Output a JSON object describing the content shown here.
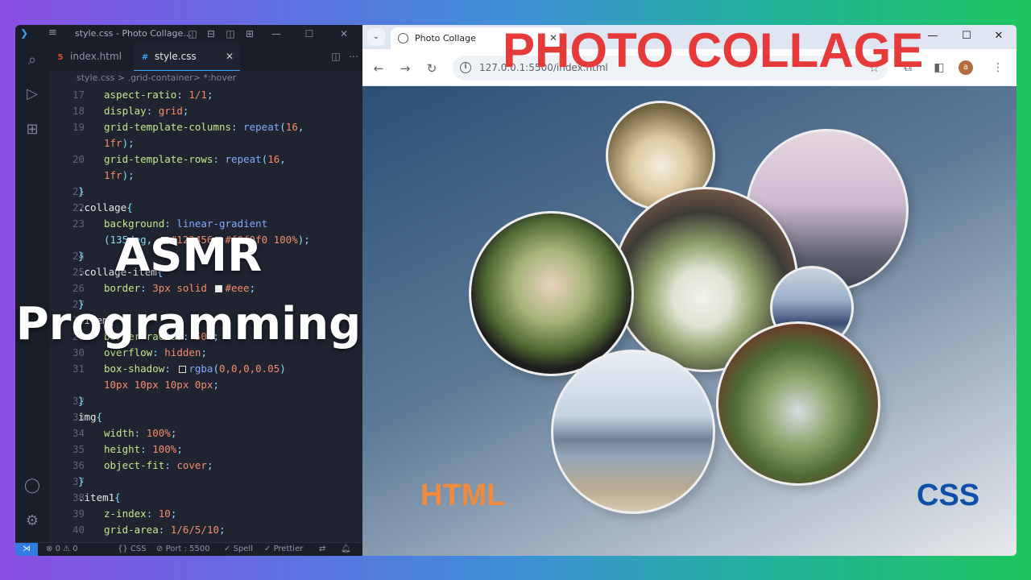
{
  "headline": "PHOTO COLLAGE",
  "overlay": {
    "line1": "ASMR",
    "line2": "Programming"
  },
  "vscode": {
    "window_title": "style.css - Photo Collage...",
    "tabs": [
      {
        "label": "index.html",
        "icon": "html5-icon"
      },
      {
        "label": "style.css",
        "icon": "css-icon"
      }
    ],
    "breadcrumb": {
      "file": "style.css",
      "sep": ">",
      "symbol": ".grid-container> *:hover"
    },
    "lines": [
      {
        "n": "17",
        "parts": [
          [
            "prop",
            "aspect-ratio"
          ],
          [
            "punct",
            ": "
          ],
          [
            "num",
            "1/1"
          ],
          [
            "punct",
            ";"
          ]
        ]
      },
      {
        "n": "18",
        "parts": [
          [
            "prop",
            "display"
          ],
          [
            "punct",
            ": "
          ],
          [
            "val",
            "grid"
          ],
          [
            "punct",
            ";"
          ]
        ]
      },
      {
        "n": "19",
        "parts": [
          [
            "prop",
            "grid-template-columns"
          ],
          [
            "punct",
            ": "
          ],
          [
            "fn",
            "repeat"
          ],
          [
            "punct",
            "("
          ],
          [
            "num",
            "16"
          ],
          [
            "punct",
            ","
          ]
        ]
      },
      {
        "n": "",
        "parts": [
          [
            "num",
            "1fr"
          ],
          [
            "punct",
            ");"
          ]
        ]
      },
      {
        "n": "20",
        "parts": [
          [
            "prop",
            "grid-template-rows"
          ],
          [
            "punct",
            ": "
          ],
          [
            "fn",
            "repeat"
          ],
          [
            "punct",
            "("
          ],
          [
            "num",
            "16"
          ],
          [
            "punct",
            ","
          ]
        ]
      },
      {
        "n": "",
        "parts": [
          [
            "num",
            "1fr"
          ],
          [
            "punct",
            ");"
          ]
        ]
      },
      {
        "n": "21",
        "indent": 0,
        "parts": [
          [
            "punct",
            "}"
          ]
        ]
      },
      {
        "n": "22",
        "indent": 0,
        "parts": [
          [
            "sel",
            ".collage"
          ],
          [
            "punct",
            "{"
          ]
        ]
      },
      {
        "n": "23",
        "parts": [
          [
            "prop",
            "background"
          ],
          [
            "punct",
            ": "
          ],
          [
            "fn",
            "linear-gradient"
          ]
        ]
      },
      {
        "n": "",
        "parts": [
          [
            "punct",
            "(135deg, "
          ],
          [
            "swatch",
            "#123456"
          ],
          [
            "num",
            "#123456"
          ],
          [
            "swatch",
            "#f0f0f0"
          ],
          [
            "num",
            "#f0f0f0 100%"
          ],
          [
            "punct",
            ");"
          ]
        ]
      },
      {
        "n": "24",
        "indent": 0,
        "parts": [
          [
            "punct",
            "}"
          ]
        ]
      },
      {
        "n": "25",
        "indent": 0,
        "parts": [
          [
            "sel",
            ".collage-item"
          ],
          [
            "punct",
            "{"
          ]
        ]
      },
      {
        "n": "26",
        "parts": [
          [
            "prop",
            "border"
          ],
          [
            "punct",
            ": "
          ],
          [
            "num",
            "3px"
          ],
          [
            "val",
            " solid "
          ],
          [
            "swatch",
            "#eee"
          ],
          [
            "num",
            "#eee"
          ],
          [
            "punct",
            ";"
          ]
        ]
      },
      {
        "n": "27",
        "indent": 0,
        "parts": [
          [
            "punct",
            "}"
          ]
        ]
      },
      {
        "n": "28",
        "indent": 0,
        "parts": [
          [
            "sel",
            ".item"
          ],
          [
            "punct",
            "{"
          ]
        ]
      },
      {
        "n": "29",
        "parts": [
          [
            "prop",
            "border-radius"
          ],
          [
            "punct",
            ": "
          ],
          [
            "num",
            "50%"
          ],
          [
            "punct",
            ";"
          ]
        ]
      },
      {
        "n": "30",
        "parts": [
          [
            "prop",
            "overflow"
          ],
          [
            "punct",
            ": "
          ],
          [
            "val",
            "hidden"
          ],
          [
            "punct",
            ";"
          ]
        ]
      },
      {
        "n": "31",
        "parts": [
          [
            "prop",
            "box-shadow"
          ],
          [
            "punct",
            ": "
          ],
          [
            "swatch",
            "rgba(0,0,0,0.05)"
          ],
          [
            "fn",
            "rgba"
          ],
          [
            "punct",
            "("
          ],
          [
            "num",
            "0,0,0,0.05"
          ],
          [
            "punct",
            ")"
          ]
        ]
      },
      {
        "n": "",
        "parts": [
          [
            "num",
            "10px 10px 10px 0px"
          ],
          [
            "punct",
            ";"
          ]
        ]
      },
      {
        "n": "32",
        "indent": 0,
        "parts": [
          [
            "punct",
            "}"
          ]
        ]
      },
      {
        "n": "33",
        "indent": 0,
        "parts": [
          [
            "sel",
            "img"
          ],
          [
            "punct",
            "{"
          ]
        ]
      },
      {
        "n": "34",
        "parts": [
          [
            "prop",
            "width"
          ],
          [
            "punct",
            ": "
          ],
          [
            "num",
            "100%"
          ],
          [
            "punct",
            ";"
          ]
        ]
      },
      {
        "n": "35",
        "parts": [
          [
            "prop",
            "height"
          ],
          [
            "punct",
            ": "
          ],
          [
            "num",
            "100%"
          ],
          [
            "punct",
            ";"
          ]
        ]
      },
      {
        "n": "36",
        "parts": [
          [
            "prop",
            "object-fit"
          ],
          [
            "punct",
            ": "
          ],
          [
            "val",
            "cover"
          ],
          [
            "punct",
            ";"
          ]
        ]
      },
      {
        "n": "37",
        "indent": 0,
        "parts": [
          [
            "punct",
            "}"
          ]
        ]
      },
      {
        "n": "38",
        "indent": 0,
        "parts": [
          [
            "sel",
            ".item1"
          ],
          [
            "punct",
            "{"
          ]
        ]
      },
      {
        "n": "39",
        "parts": [
          [
            "prop",
            "z-index"
          ],
          [
            "punct",
            ": "
          ],
          [
            "num",
            "10"
          ],
          [
            "punct",
            ";"
          ]
        ]
      },
      {
        "n": "40",
        "parts": [
          [
            "prop",
            "grid-area"
          ],
          [
            "punct",
            ": "
          ],
          [
            "num",
            "1/6/5/10"
          ],
          [
            "punct",
            ";"
          ]
        ]
      }
    ],
    "status": {
      "errors": "0",
      "warnings": "0",
      "lang": "CSS",
      "port": "Port : 5500",
      "spell": "Spell",
      "prettier": "Prettier"
    }
  },
  "browser": {
    "tab_title": "Photo Collage",
    "url": "127.0.0.1:5500/index.html",
    "avatar_letter": "a",
    "label_html": "HTML",
    "label_css": "CSS"
  },
  "colors": {
    "headline": "#e63a3a",
    "html_label": "#f08a3c",
    "css_label": "#0f4fa8",
    "editor_bg": "#1f2430"
  },
  "photos": [
    {
      "name": "rings-photo",
      "desc": "wedding rings"
    },
    {
      "name": "beach-couple-photo",
      "desc": "couple on beach"
    },
    {
      "name": "bouquet-photo",
      "desc": "bouquet and kiss"
    },
    {
      "name": "forest-couple-photo",
      "desc": "couple in forest"
    },
    {
      "name": "boat-couple-photo",
      "desc": "couple on boat"
    },
    {
      "name": "lake-couple-photo",
      "desc": "couple by lake"
    },
    {
      "name": "trees-couple-photo",
      "desc": "couple among trees"
    }
  ]
}
